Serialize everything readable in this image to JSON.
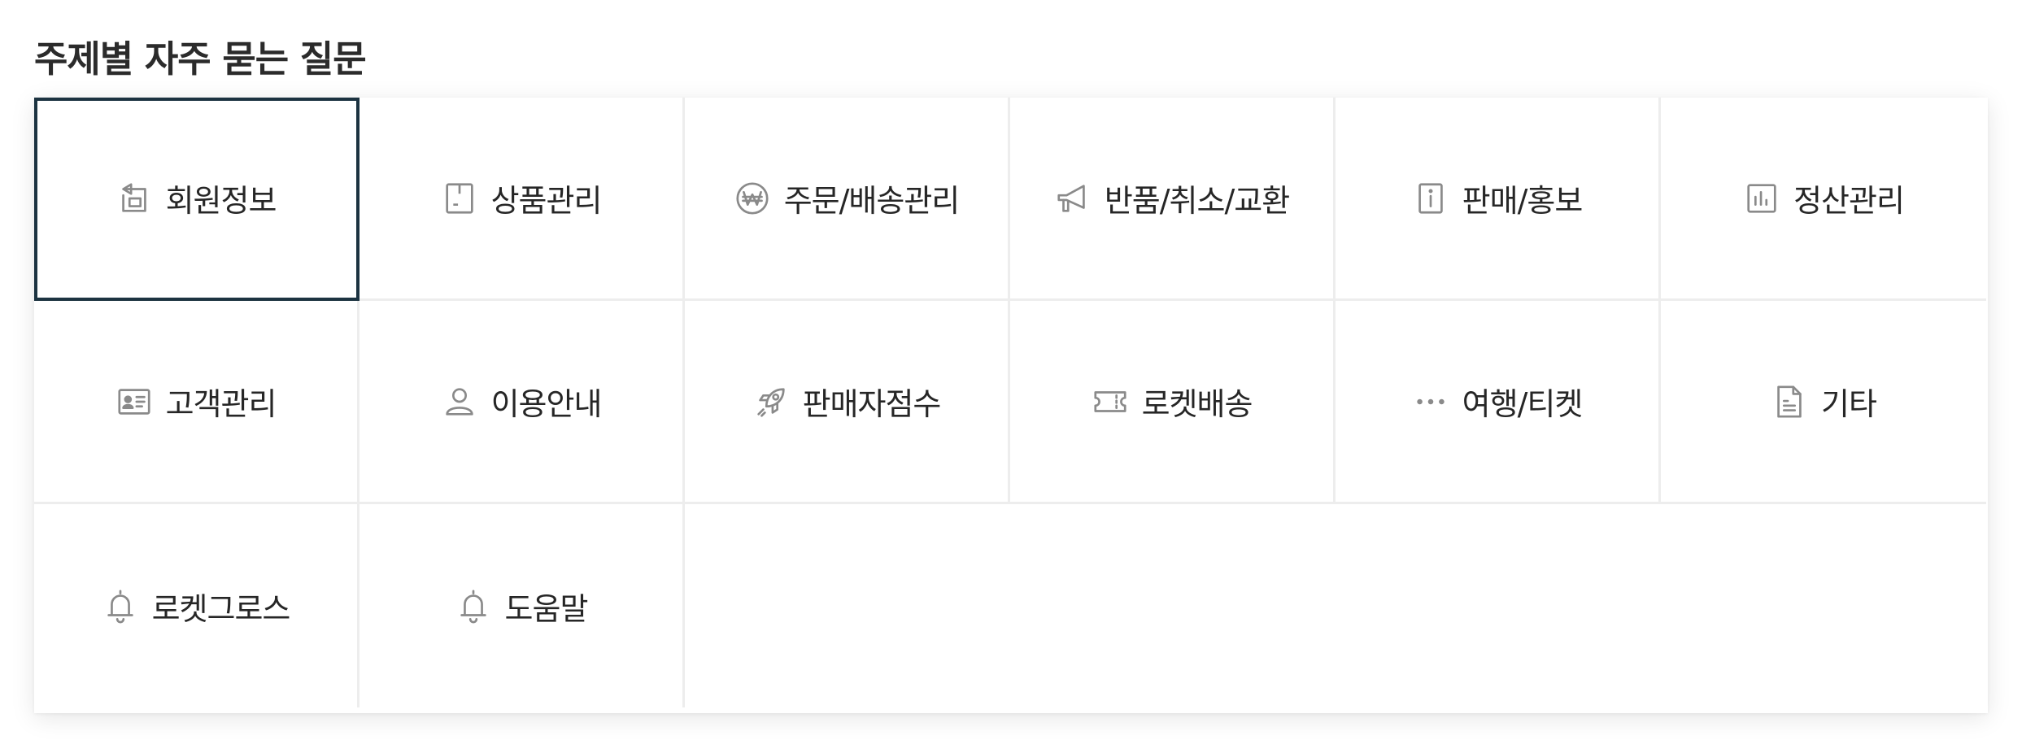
{
  "title": "주제별 자주 묻는 질문",
  "categories": [
    {
      "label": "회원정보",
      "icon": "member-info-icon"
    },
    {
      "label": "상품관리",
      "icon": "product-box-icon"
    },
    {
      "label": "주문/배송관리",
      "icon": "won-coin-icon"
    },
    {
      "label": "반품/취소/교환",
      "icon": "megaphone-icon"
    },
    {
      "label": "판매/홍보",
      "icon": "info-icon"
    },
    {
      "label": "정산관리",
      "icon": "bar-chart-icon"
    },
    {
      "label": "고객관리",
      "icon": "id-card-icon"
    },
    {
      "label": "이용안내",
      "icon": "user-icon"
    },
    {
      "label": "판매자점수",
      "icon": "rocket-icon"
    },
    {
      "label": "로켓배송",
      "icon": "ticket-icon"
    },
    {
      "label": "여행/티켓",
      "icon": "more-dots-icon"
    },
    {
      "label": "기타",
      "icon": "document-icon"
    },
    {
      "label": "로켓그로스",
      "icon": "bell-icon"
    },
    {
      "label": "도움말",
      "icon": "bell-icon"
    }
  ],
  "selected_index": 0,
  "colors": {
    "active_border": "#1c3341",
    "icon": "#8a8a8a",
    "divider": "#ededed"
  }
}
